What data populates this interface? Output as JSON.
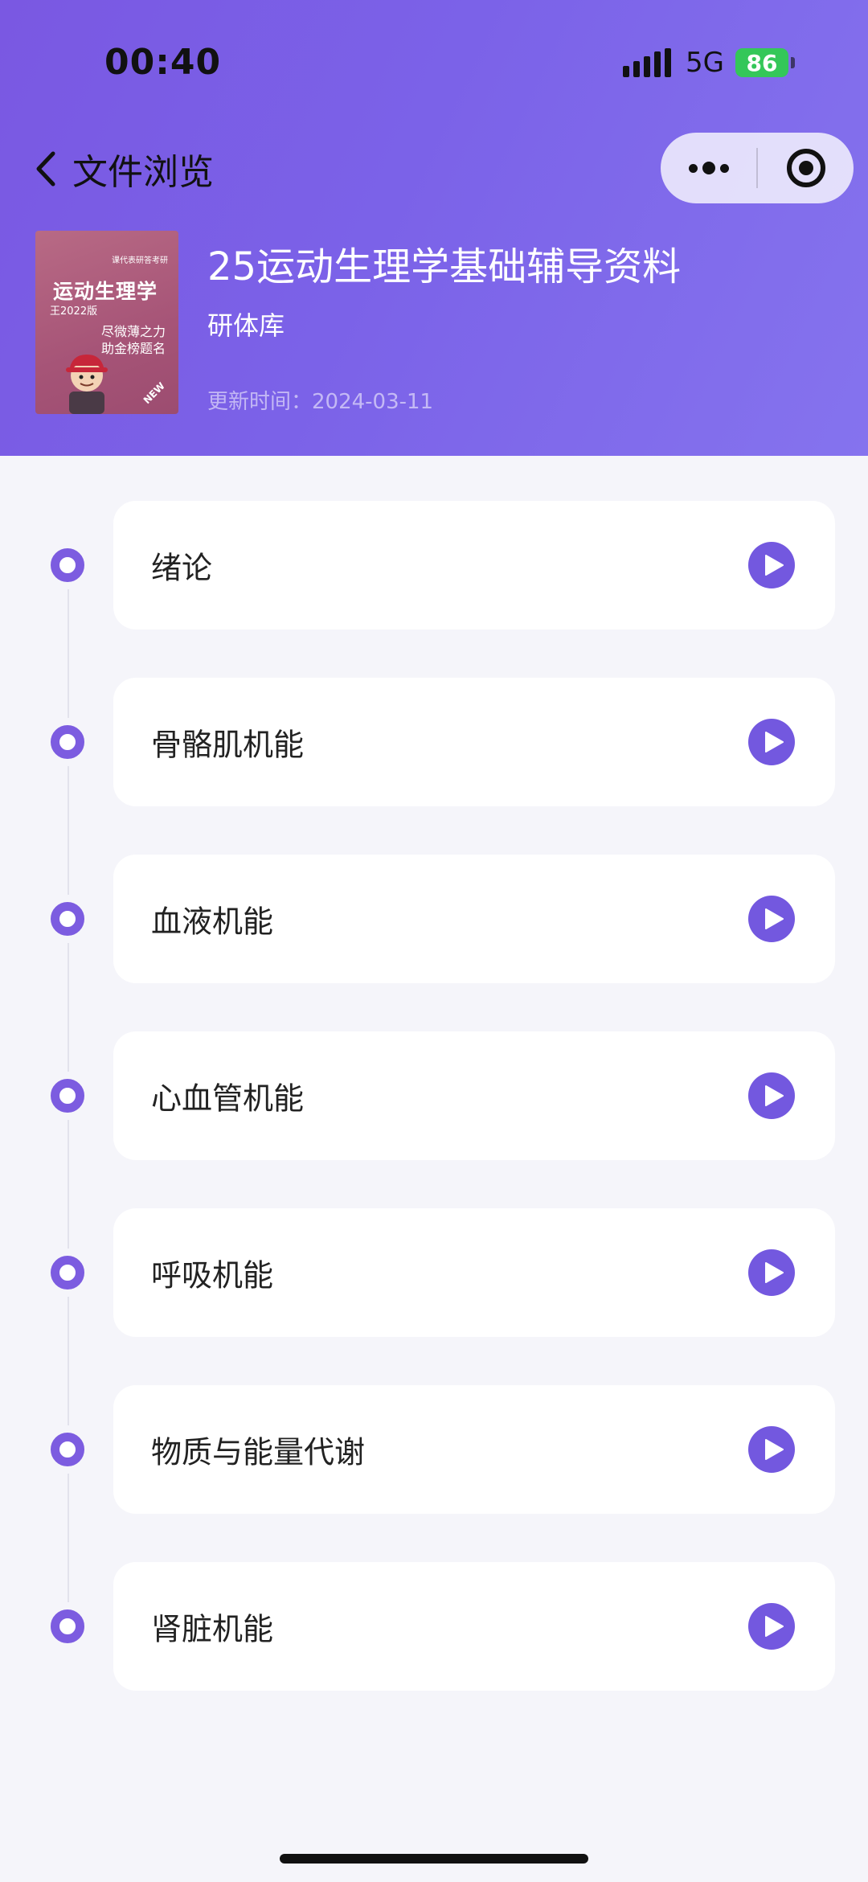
{
  "status_bar": {
    "time": "00:40",
    "network": "5G",
    "battery": "86"
  },
  "nav": {
    "back_icon": "chevron-left-icon",
    "title": "文件浏览",
    "menu_icon": "more-dots-icon",
    "close_icon": "target-circle-icon"
  },
  "cover": {
    "brand": "课代表研答考研",
    "title": "运动生理学",
    "edition": "王2022版",
    "slogan_line1": "尽微薄之力",
    "slogan_line2": "助金榜题名",
    "badge": "NEW"
  },
  "document": {
    "title": "25运动生理学基础辅导资料",
    "source": "研体库",
    "updated": "更新时间：2024-03-11"
  },
  "chapters": [
    {
      "label": "绪论"
    },
    {
      "label": "骨骼肌机能"
    },
    {
      "label": "血液机能"
    },
    {
      "label": "心血管机能"
    },
    {
      "label": "呼吸机能"
    },
    {
      "label": "物质与能量代谢"
    },
    {
      "label": "肾脏机能"
    }
  ],
  "colors": {
    "accent": "#7358df",
    "header_start": "#7a58e2",
    "header_end": "#8573ee",
    "background": "#f5f5fa",
    "card": "#ffffff"
  }
}
